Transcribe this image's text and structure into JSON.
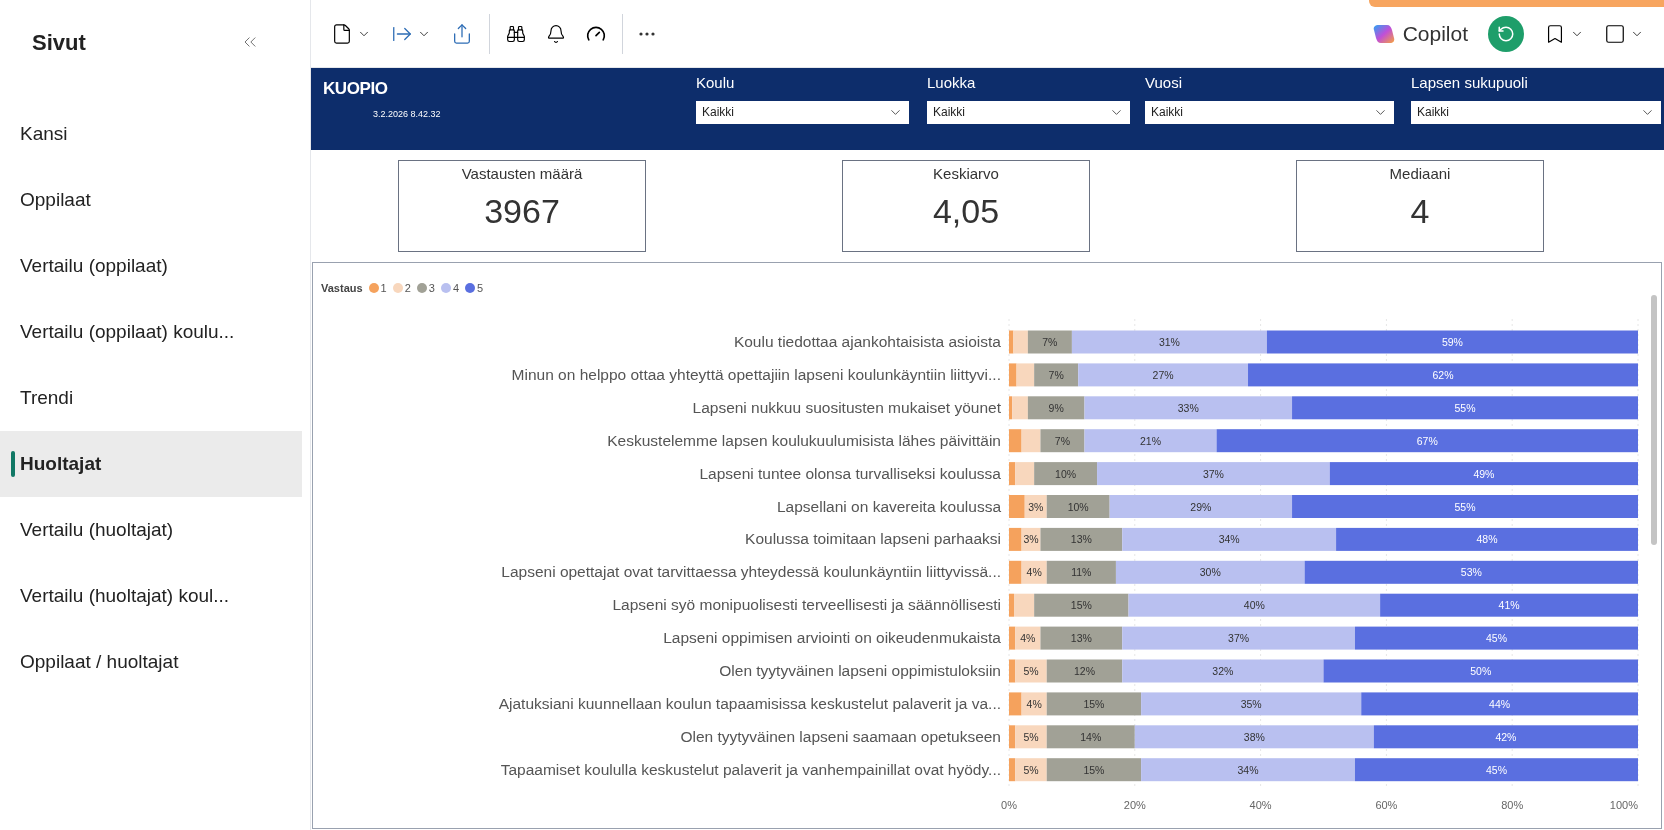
{
  "sidebar": {
    "title": "Sivut",
    "items": [
      {
        "label": "Kansi",
        "selected": false
      },
      {
        "label": "Oppilaat",
        "selected": false
      },
      {
        "label": "Vertailu (oppilaat)",
        "selected": false
      },
      {
        "label": "Vertailu (oppilaat) koulu...",
        "selected": false
      },
      {
        "label": "Trendi",
        "selected": false
      },
      {
        "label": "Huoltajat",
        "selected": true
      },
      {
        "label": "Vertailu (huoltajat)",
        "selected": false
      },
      {
        "label": "Vertailu (huoltajat) koul...",
        "selected": false
      },
      {
        "label": "Oppilaat / huoltajat",
        "selected": false
      }
    ]
  },
  "toolbar": {
    "copilot_label": "Copilot"
  },
  "report": {
    "header": {
      "logo": "KUOPIO",
      "timestamp": "3.2.2026 8.42.32",
      "filters": [
        {
          "label": "Koulu",
          "value": "Kaikki"
        },
        {
          "label": "Luokka",
          "value": "Kaikki"
        },
        {
          "label": "Vuosi",
          "value": "Kaikki"
        },
        {
          "label": "Lapsen sukupuoli",
          "value": "Kaikki"
        }
      ]
    },
    "kpis": [
      {
        "title": "Vastausten määrä",
        "value": "3967"
      },
      {
        "title": "Keskiarvo",
        "value": "4,05"
      },
      {
        "title": "Mediaani",
        "value": "4"
      }
    ],
    "chart": {
      "legend_title": "Vastaus",
      "chart_data": {
        "type": "bar",
        "orientation": "horizontal",
        "stacked": true,
        "categories": [
          "Koulu tiedottaa ajankohtaisista asioista",
          "Minun on helppo ottaa yhteyttä opettajiin lapseni koulunkäyntiin liittyvi...",
          "Lapseni nukkuu suositusten mukaiset yöunet",
          "Keskustelemme lapsen koulukuulumisista lähes päivittäin",
          "Lapseni tuntee olonsa turvalliseksi koulussa",
          "Lapsellani on kavereita koulussa",
          "Koulussa toimitaan lapseni parhaaksi",
          "Lapseni opettajat ovat tarvittaessa yhteydessä koulunkäyntiin liittyvissä...",
          "Lapseni syö monipuolisesti terveellisesti ja säännöllisesti",
          "Lapseni oppimisen arviointi on oikeudenmukaista",
          "Olen tyytyväinen lapseni oppimistuloksiin",
          "Ajatuksiani kuunnellaan koulun tapaamisissa keskustelut palaverit ja va...",
          "Olen tyytyväinen lapseni saamaan opetukseen",
          "Tapaamiset koululla keskustelut palaverit ja vanhempainillat ovat hyödy..."
        ],
        "series": [
          {
            "name": "1",
            "color": "#f5a25d",
            "values": [
              0.7,
              1.2,
              0.5,
              2,
              1,
              2.5,
              2,
              2,
              0.8,
              1,
              1,
              2,
              1,
              1
            ]
          },
          {
            "name": "2",
            "color": "#f8d7bd",
            "values": [
              2.3,
              2.8,
              2.5,
              3,
              3,
              3.5,
              3,
              4,
              3.2,
              4,
              5,
              4,
              5,
              5
            ]
          },
          {
            "name": "3",
            "color": "#a1a196",
            "values": [
              7,
              7,
              9,
              7,
              10,
              10,
              13,
              11,
              15,
              13,
              12,
              15,
              14,
              15
            ]
          },
          {
            "name": "4",
            "color": "#b9c0f0",
            "values": [
              31,
              27,
              33,
              21,
              37,
              29,
              34,
              30,
              40,
              37,
              32,
              35,
              38,
              34
            ]
          },
          {
            "name": "5",
            "color": "#5a6fe0",
            "values": [
              59,
              62,
              55,
              67,
              49,
              55,
              48,
              53,
              41,
              45,
              50,
              44,
              42,
              45
            ]
          }
        ],
        "value_labels": [
          [
            null,
            null,
            null,
            null,
            null,
            null,
            null,
            null,
            null,
            null,
            null,
            null,
            null,
            null
          ],
          [
            null,
            null,
            null,
            null,
            null,
            "3%",
            "3%",
            "4%",
            null,
            "4%",
            "5%",
            "4%",
            "5%",
            "5%"
          ],
          [
            "7%",
            "7%",
            "9%",
            "7%",
            "10%",
            "10%",
            "13%",
            "11%",
            "15%",
            "13%",
            "12%",
            "15%",
            "14%",
            "15%"
          ],
          [
            "31%",
            "27%",
            "33%",
            "21%",
            "37%",
            "29%",
            "34%",
            "30%",
            "40%",
            "37%",
            "32%",
            "35%",
            "38%",
            "34%"
          ],
          [
            "59%",
            "62%",
            "55%",
            "67%",
            "49%",
            "55%",
            "48%",
            "53%",
            "41%",
            "45%",
            "50%",
            "44%",
            "42%",
            "45%"
          ]
        ],
        "xlim": [
          0,
          100
        ],
        "grid": true,
        "xticks": [
          {
            "value": 0,
            "label": "0%"
          },
          {
            "value": 20,
            "label": "20%"
          },
          {
            "value": 40,
            "label": "40%"
          },
          {
            "value": 60,
            "label": "60%"
          },
          {
            "value": 80,
            "label": "80%"
          },
          {
            "value": 100,
            "label": "100%"
          }
        ]
      }
    }
  }
}
